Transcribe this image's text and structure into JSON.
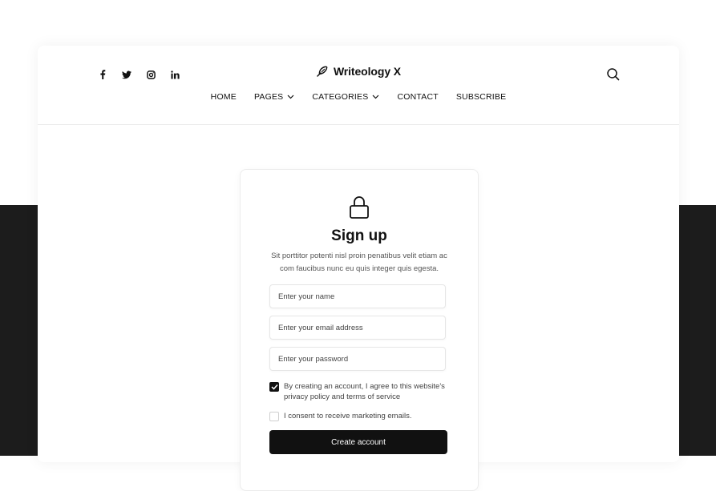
{
  "header": {
    "brand": "Writeology X",
    "socials": [
      "facebook-icon",
      "twitter-icon",
      "instagram-icon",
      "linkedin-icon"
    ],
    "nav": [
      {
        "label": "HOME",
        "dropdown": false
      },
      {
        "label": "PAGES",
        "dropdown": true
      },
      {
        "label": "CATEGORIES",
        "dropdown": true
      },
      {
        "label": "CONTACT",
        "dropdown": false
      },
      {
        "label": "SUBSCRIBE",
        "dropdown": false
      }
    ]
  },
  "signup": {
    "title": "Sign up",
    "subtitle": "Sit porttitor potenti nisl proin penatibus velit etiam ac com faucibus nunc eu quis integer quis egesta.",
    "name_placeholder": "Enter your name",
    "email_placeholder": "Enter your email address",
    "password_placeholder": "Enter your password",
    "terms_label": "By creating an account, I agree to this website's privacy policy and terms of service",
    "terms_checked": true,
    "marketing_label": "I consent to receive marketing emails.",
    "marketing_checked": false,
    "submit_label": "Create account"
  },
  "colors": {
    "dark_band": "#1c1c1c",
    "button": "#111111"
  }
}
